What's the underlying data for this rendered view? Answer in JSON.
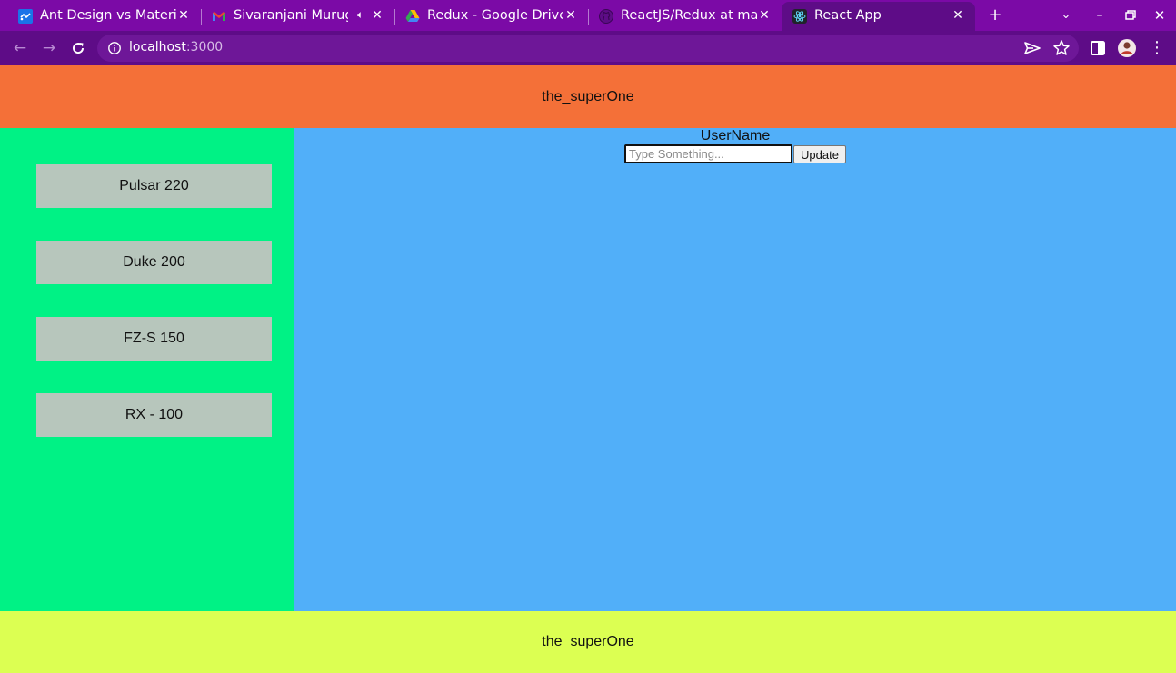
{
  "browser": {
    "tabs": [
      {
        "title": "Ant Design vs Materia",
        "icon": "tabs-favicon"
      },
      {
        "title": "Sivaranjani Murug",
        "icon": "gmail-favicon",
        "audio": true
      },
      {
        "title": "Redux - Google Drive",
        "icon": "google-drive-favicon"
      },
      {
        "title": "ReactJS/Redux at mai",
        "icon": "github-favicon"
      },
      {
        "title": "React App",
        "icon": "react-favicon",
        "active": true
      }
    ],
    "url_host": "localhost",
    "url_port": ":3000"
  },
  "app": {
    "header_title": "the_superOne",
    "footer_title": "the_superOne",
    "sidebar": {
      "items": [
        {
          "label": "Pulsar 220"
        },
        {
          "label": "Duke 200"
        },
        {
          "label": "FZ-S 150"
        },
        {
          "label": "RX - 100"
        }
      ]
    },
    "main": {
      "username_label": "UserName",
      "input_placeholder": "Type Something...",
      "input_value": "",
      "update_label": "Update"
    }
  },
  "colors": {
    "tab_strip": "#7b0aa6",
    "toolbar": "#5e0c87",
    "header": "#f47038",
    "sidebar": "#00f285",
    "sidebar_button": "#b7c6bc",
    "main": "#51aff9",
    "footer": "#dcff52"
  }
}
